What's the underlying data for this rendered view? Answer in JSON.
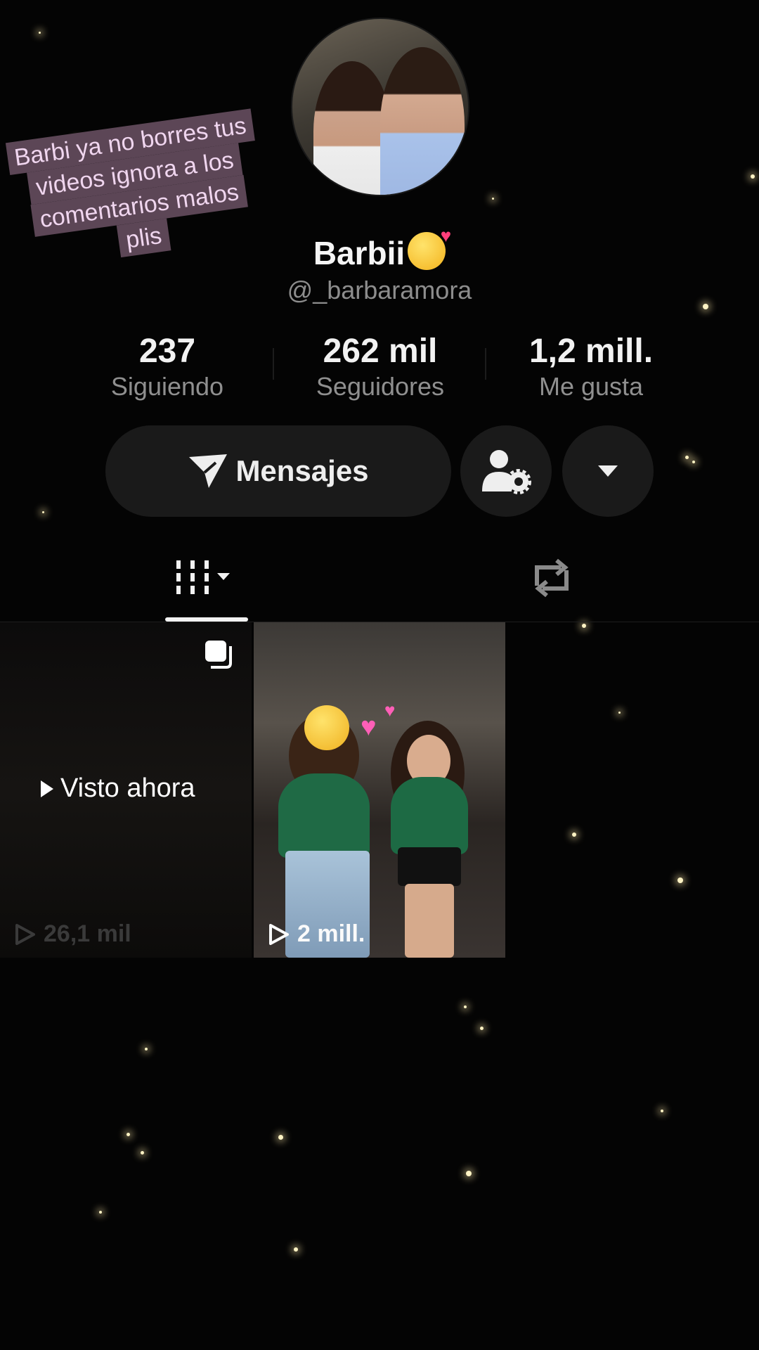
{
  "profile": {
    "display_name": "Barbii",
    "username": "@_barbaramora"
  },
  "sticker": {
    "lines": [
      "Barbi ya no borres tus",
      "videos ignora a los",
      "comentarios malos",
      "plis"
    ]
  },
  "stats": [
    {
      "value": "237",
      "label": "Siguiendo"
    },
    {
      "value": "262 mil",
      "label": "Seguidores"
    },
    {
      "value": "1,2 mill.",
      "label": "Me gusta"
    }
  ],
  "actions": {
    "messages_label": "Mensajes"
  },
  "tabs": {
    "active": "videos"
  },
  "videos": [
    {
      "views": "26,1 mil",
      "overlay": "Visto ahora"
    },
    {
      "views": "2 mill."
    }
  ],
  "colors": {
    "background": "#040404",
    "button_bg": "#1a1a1a",
    "sticker_bg": "#5c4656",
    "sticker_text": "#f0d6ef",
    "muted_text": "#8f8f8f"
  },
  "icons": {
    "messages": "paper-plane-icon",
    "add_friend": "person-gear-icon",
    "more": "caret-down-icon",
    "videos_tab": "grid-icon",
    "repost_tab": "repost-icon",
    "multi": "multi-photo-icon",
    "play": "play-outline-icon"
  }
}
